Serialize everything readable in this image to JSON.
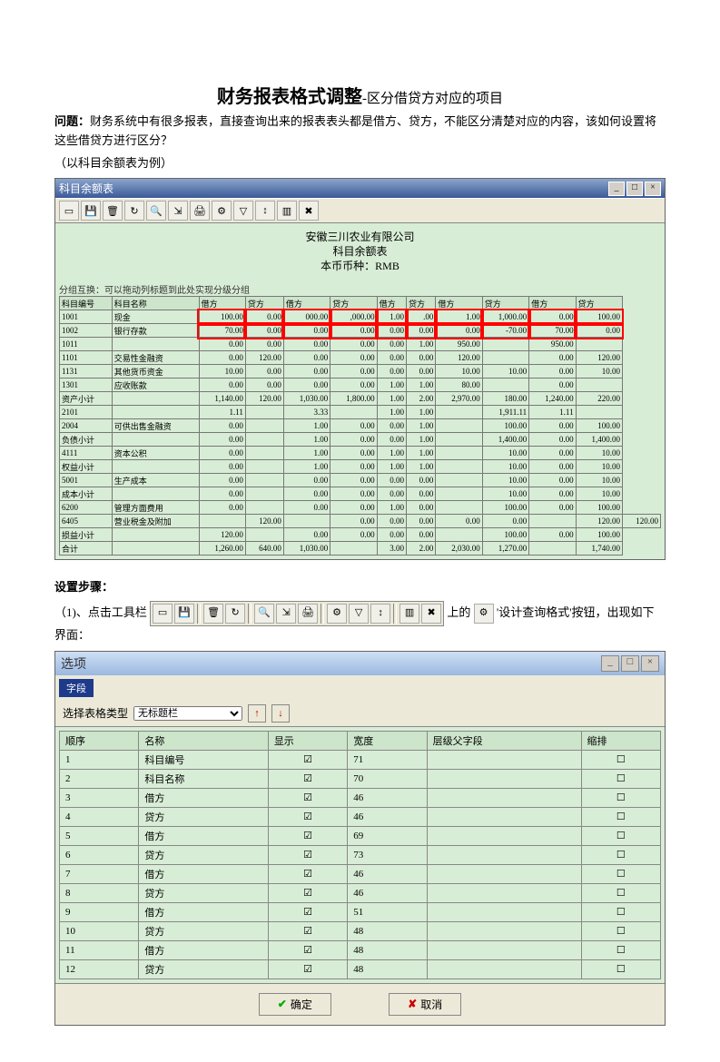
{
  "doc": {
    "title": "财务报表格式调整",
    "title_sub": "-区分借贷方对应的项目",
    "q_label": "问题：",
    "q_text": "财务系统中有很多报表，直接查询出来的报表表头都是借方、贷方，不能区分清楚对应的内容，该如何设置将这些借贷方进行区分？",
    "example": "（以科目余额表为例）",
    "steps_head": "设置步骤：",
    "step1a": "（1)、点击工具栏",
    "step1b": "上的",
    "step1c": "'设计查询格式'按钮，出现如下界面："
  },
  "win1": {
    "title": "科目余额表",
    "company": "安徽三川农业有限公司",
    "subtitle": "科目余额表",
    "currency": "本币币种：RMB",
    "hint": "分组互换：可以拖动列标题到此处实现分级分组",
    "headers": [
      "科目编号",
      "科目名称",
      "借方",
      "贷方",
      "借方",
      "贷方",
      "借方",
      "贷方",
      "借方",
      "贷方",
      "借方",
      "贷方"
    ],
    "rows": [
      [
        "1001",
        "现金",
        "100.00",
        "0.00",
        "000.00",
        ",000.00",
        "1.00",
        ".00",
        "1.00",
        "1,000.00",
        "0.00",
        "100.00"
      ],
      [
        "1002",
        "银行存款",
        "70.00",
        "0.00",
        "0.00",
        "0.00",
        "0.00",
        "0.00",
        "0.00",
        "-70.00",
        "70.00",
        "0.00"
      ],
      [
        "1011",
        "",
        "0.00",
        "0.00",
        "0.00",
        "0.00",
        "0.00",
        "1.00",
        "950.00",
        "",
        "950.00",
        ""
      ],
      [
        "1101",
        "交易性金融资",
        "0.00",
        "120.00",
        "0.00",
        "0.00",
        "0.00",
        "0.00",
        "120.00",
        "",
        "0.00",
        "120.00"
      ],
      [
        "1131",
        "其他货币资金",
        "10.00",
        "0.00",
        "0.00",
        "0.00",
        "0.00",
        "0.00",
        "10.00",
        "10.00",
        "0.00",
        "10.00"
      ],
      [
        "1301",
        "应收账款",
        "0.00",
        "0.00",
        "0.00",
        "0.00",
        "1.00",
        "1.00",
        "80.00",
        "",
        "0.00",
        ""
      ],
      [
        "资产小计",
        "",
        "1,140.00",
        "120.00",
        "1,030.00",
        "1,800.00",
        "1.00",
        "2.00",
        "2,970.00",
        "180.00",
        "1,240.00",
        "220.00"
      ],
      [
        "2101",
        "",
        "1.11",
        "",
        "3.33",
        "",
        "1.00",
        "1.00",
        "",
        "1,911.11",
        "1.11",
        ""
      ],
      [
        "2004",
        "可供出售金融资",
        "0.00",
        "",
        "1.00",
        "0.00",
        "0.00",
        "1.00",
        "",
        "100.00",
        "0.00",
        "100.00"
      ],
      [
        "负债小计",
        "",
        "0.00",
        "",
        "1.00",
        "0.00",
        "0.00",
        "1.00",
        "",
        "1,400.00",
        "0.00",
        "1,400.00"
      ],
      [
        "4111",
        "资本公积",
        "0.00",
        "",
        "1.00",
        "0.00",
        "1.00",
        "1.00",
        "",
        "10.00",
        "0.00",
        "10.00"
      ],
      [
        "权益小计",
        "",
        "0.00",
        "",
        "1.00",
        "0.00",
        "1.00",
        "1.00",
        "",
        "10.00",
        "0.00",
        "10.00"
      ],
      [
        "5001",
        "生产成本",
        "0.00",
        "",
        "0.00",
        "0.00",
        "0.00",
        "0.00",
        "",
        "10.00",
        "0.00",
        "10.00"
      ],
      [
        "成本小计",
        "",
        "0.00",
        "",
        "0.00",
        "0.00",
        "0.00",
        "0.00",
        "",
        "10.00",
        "0.00",
        "10.00"
      ],
      [
        "6200",
        "管理方面费用",
        "0.00",
        "",
        "0.00",
        "0.00",
        "1.00",
        "0.00",
        "",
        "100.00",
        "0.00",
        "100.00"
      ],
      [
        "6405",
        "营业税金及附加",
        "",
        "120.00",
        "",
        "0.00",
        "0.00",
        "0.00",
        "0.00",
        "0.00",
        "",
        "120.00",
        "120.00"
      ],
      [
        "损益小计",
        "",
        "120.00",
        "",
        "0.00",
        "0.00",
        "0.00",
        "0.00",
        "",
        "100.00",
        "0.00",
        "100.00"
      ],
      [
        "合计",
        "",
        "1,260.00",
        "640.00",
        "1,030.00",
        "",
        "3.00",
        "2.00",
        "2,030.00",
        "1,270.00",
        "",
        "1,740.00"
      ]
    ]
  },
  "toolbar_icons": [
    "select-icon",
    "save-icon",
    "delete-icon",
    "refresh-icon",
    "query-icon",
    "export-icon",
    "print-icon",
    "design-icon",
    "filter-icon",
    "sort-icon",
    "column-icon",
    "close-icon"
  ],
  "design_icon": "design-query-icon",
  "win2": {
    "title": "选项",
    "tab": "字段",
    "type_label": "选择表格类型",
    "type_value": "无标题栏",
    "headers": [
      "顺序",
      "名称",
      "显示",
      "宽度",
      "层级父字段",
      "缩排"
    ],
    "rows": [
      {
        "seq": "1",
        "name": "科目编号",
        "show": true,
        "width": "71",
        "parent": "",
        "indent": false
      },
      {
        "seq": "2",
        "name": "科目名称",
        "show": true,
        "width": "70",
        "parent": "",
        "indent": false
      },
      {
        "seq": "3",
        "name": "借方",
        "show": true,
        "width": "46",
        "parent": "",
        "indent": false
      },
      {
        "seq": "4",
        "name": "贷方",
        "show": true,
        "width": "46",
        "parent": "",
        "indent": false
      },
      {
        "seq": "5",
        "name": "借方",
        "show": true,
        "width": "69",
        "parent": "",
        "indent": false
      },
      {
        "seq": "6",
        "name": "贷方",
        "show": true,
        "width": "73",
        "parent": "",
        "indent": false
      },
      {
        "seq": "7",
        "name": "借方",
        "show": true,
        "width": "46",
        "parent": "",
        "indent": false
      },
      {
        "seq": "8",
        "name": "贷方",
        "show": true,
        "width": "46",
        "parent": "",
        "indent": false
      },
      {
        "seq": "9",
        "name": "借方",
        "show": true,
        "width": "51",
        "parent": "",
        "indent": false
      },
      {
        "seq": "10",
        "name": "贷方",
        "show": true,
        "width": "48",
        "parent": "",
        "indent": false
      },
      {
        "seq": "11",
        "name": "借方",
        "show": true,
        "width": "48",
        "parent": "",
        "indent": false
      },
      {
        "seq": "12",
        "name": "贷方",
        "show": true,
        "width": "48",
        "parent": "",
        "indent": false
      }
    ],
    "ok": "确定",
    "cancel": "取消"
  }
}
